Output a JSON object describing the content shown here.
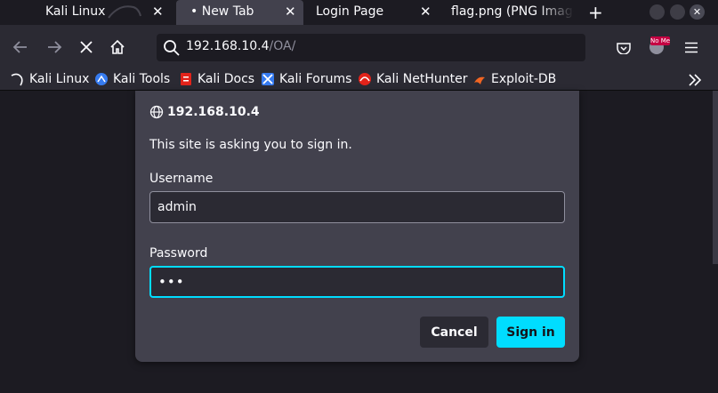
{
  "tabs": [
    {
      "label": "Kali Linux",
      "active": false
    },
    {
      "label": "New Tab",
      "active": true,
      "dot": "•"
    },
    {
      "label": "Login Page",
      "active": false
    },
    {
      "label": "flag.png (PNG Image",
      "active": false
    }
  ],
  "tab_close_glyph": "✕",
  "new_tab_glyph": "+",
  "window_close_glyph": "✕",
  "url": {
    "host": "192.168.10.4",
    "path": "/OA/"
  },
  "extension_badge": "No Me",
  "bookmarks": [
    {
      "label": "Kali Linux",
      "icon": "kali-dragon-icon"
    },
    {
      "label": "Kali Tools",
      "icon": "kali-tools-icon"
    },
    {
      "label": "Kali Docs",
      "icon": "kali-docs-icon"
    },
    {
      "label": "Kali Forums",
      "icon": "kali-forums-icon"
    },
    {
      "label": "Kali NetHunter",
      "icon": "nethunter-icon"
    },
    {
      "label": "Exploit-DB",
      "icon": "exploit-db-icon"
    }
  ],
  "dialog": {
    "host": "192.168.10.4",
    "message": "This site is asking you to sign in.",
    "username_label": "Username",
    "username_value": "admin",
    "password_label": "Password",
    "password_value": "•••",
    "cancel_label": "Cancel",
    "signin_label": "Sign in"
  },
  "colors": {
    "accent": "#00ddff",
    "dialog_bg": "#42414d",
    "toolbar_bg": "#2b2a33",
    "page_bg": "#1c1b22"
  }
}
